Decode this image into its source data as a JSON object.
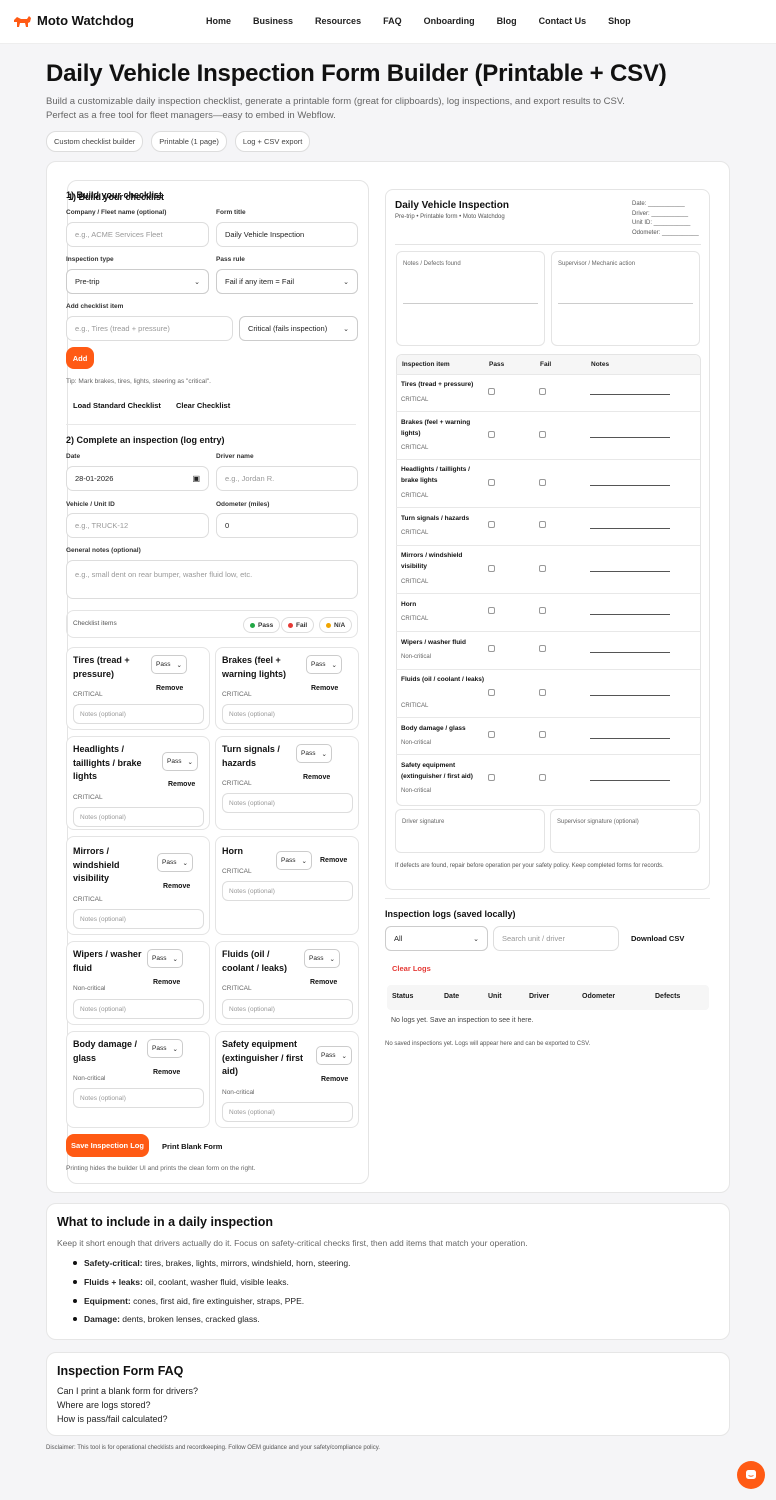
{
  "brand": {
    "name": "Moto Watchdog",
    "accent": "#ff5a14"
  },
  "nav": [
    "Home",
    "Business",
    "Resources",
    "FAQ",
    "Onboarding",
    "Blog",
    "Contact Us",
    "Shop"
  ],
  "hero": {
    "title": "Daily Vehicle Inspection Form Builder (Printable + CSV)",
    "subtitle": "Build a customizable daily inspection checklist, generate a printable form (great for clipboards), log inspections, and export results to CSV. Perfect as a free tool for fleet managers—easy to embed in Webflow.",
    "chips": [
      "Custom checklist builder",
      "Printable (1 page)",
      "Log + CSV export"
    ]
  },
  "build": {
    "heading": "1) Build your checklist",
    "company_label": "Company / Fleet name (optional)",
    "company_placeholder": "e.g., ACME Services Fleet",
    "form_title_label": "Form title",
    "form_title_value": "Daily Vehicle Inspection",
    "type_label": "Inspection type",
    "type_value": "Pre-trip",
    "rule_label": "Pass rule",
    "rule_value": "Fail if any item = Fail",
    "add_label": "Add checklist item",
    "add_placeholder": "e.g., Tires (tread + pressure)",
    "severity_value": "Critical (fails inspection)",
    "add_button": "Add",
    "tip": "Tip: Mark brakes, tires, lights, steering as \"critical\".",
    "load_standard": "Load Standard Checklist",
    "clear": "Clear Checklist"
  },
  "complete": {
    "heading": "2) Complete an inspection (log entry)",
    "date_label": "Date",
    "date_value": "28-01-2026",
    "driver_label": "Driver name",
    "driver_placeholder": "e.g., Jordan R.",
    "vehicle_label": "Vehicle / Unit ID",
    "vehicle_placeholder": "e.g., TRUCK-12",
    "odometer_label": "Odometer (miles)",
    "odometer_value": "0",
    "notes_label": "General notes (optional)",
    "notes_placeholder": "e.g., small dent on rear bumper, washer fluid low, etc.",
    "checklist_label": "Checklist items",
    "legend": [
      "Pass",
      "Fail",
      "N/A"
    ],
    "legend_colors": [
      "#22a745",
      "#e53935",
      "#f0a500"
    ],
    "item_select": "Pass",
    "remove_label": "Remove",
    "notes_field_placeholder": "Notes (optional)",
    "save_button": "Save Inspection Log",
    "print_button": "Print Blank Form",
    "print_note": "Printing hides the builder UI and prints the clean form on the right."
  },
  "items": [
    {
      "name": "Tires (tread + pressure)",
      "tag": "CRITICAL"
    },
    {
      "name": "Brakes (feel + warning lights)",
      "tag": "CRITICAL"
    },
    {
      "name": "Headlights / taillights / brake lights",
      "tag": "CRITICAL"
    },
    {
      "name": "Turn signals / hazards",
      "tag": "CRITICAL"
    },
    {
      "name": "Mirrors / windshield visibility",
      "tag": "CRITICAL"
    },
    {
      "name": "Horn",
      "tag": "CRITICAL"
    },
    {
      "name": "Wipers / washer fluid",
      "tag": "Non-critical"
    },
    {
      "name": "Fluids (oil / coolant / leaks)",
      "tag": "CRITICAL"
    },
    {
      "name": "Body damage / glass",
      "tag": "Non-critical"
    },
    {
      "name": "Safety equipment (extinguisher / first aid)",
      "tag": "Non-critical"
    }
  ],
  "form": {
    "title": "Daily Vehicle Inspection",
    "sub": "Pre-trip • Printable form • Moto Watchdog",
    "meta": [
      "Date: ___________",
      "Driver: ___________",
      "Unit ID: ___________",
      "Odometer: ___________"
    ],
    "defects_label": "Notes / Defects found",
    "supervisor_label": "Supervisor / Mechanic action",
    "headers": [
      "Inspection item",
      "Pass",
      "Fail",
      "Notes"
    ],
    "driver_sig": "Driver signature",
    "supervisor_sig": "Supervisor signature (optional)",
    "footnote": "If defects are found, repair before operation per your safety policy. Keep completed forms for records."
  },
  "logs": {
    "heading": "Inspection logs (saved locally)",
    "filter_value": "All",
    "search_placeholder": "Search unit / driver",
    "download": "Download CSV",
    "clear": "Clear Logs",
    "columns": [
      "Status",
      "Date",
      "Unit",
      "Driver",
      "Odometer",
      "Defects"
    ],
    "empty": "No logs yet. Save an inspection to see it here.",
    "empty_note": "No saved inspections yet. Logs will appear here and can be exported to CSV."
  },
  "include": {
    "heading": "What to include in a daily inspection",
    "intro": "Keep it short enough that drivers actually do it. Focus on safety-critical checks first, then add items that match your operation.",
    "bullets": [
      {
        "b": "Safety-critical:",
        "t": " tires, brakes, lights, mirrors, windshield, horn, steering."
      },
      {
        "b": "Fluids + leaks:",
        "t": " oil, coolant, washer fluid, visible leaks."
      },
      {
        "b": "Equipment:",
        "t": " cones, first aid, fire extinguisher, straps, PPE."
      },
      {
        "b": "Damage:",
        "t": " dents, broken lenses, cracked glass."
      }
    ]
  },
  "faq": {
    "heading": "Inspection Form FAQ",
    "questions": [
      "Can I print a blank form for drivers?",
      "Where are logs stored?",
      "How is pass/fail calculated?"
    ]
  },
  "disclaimer": "Disclaimer: This tool is for operational checklists and recordkeeping. Follow OEM guidance and your safety/compliance policy."
}
